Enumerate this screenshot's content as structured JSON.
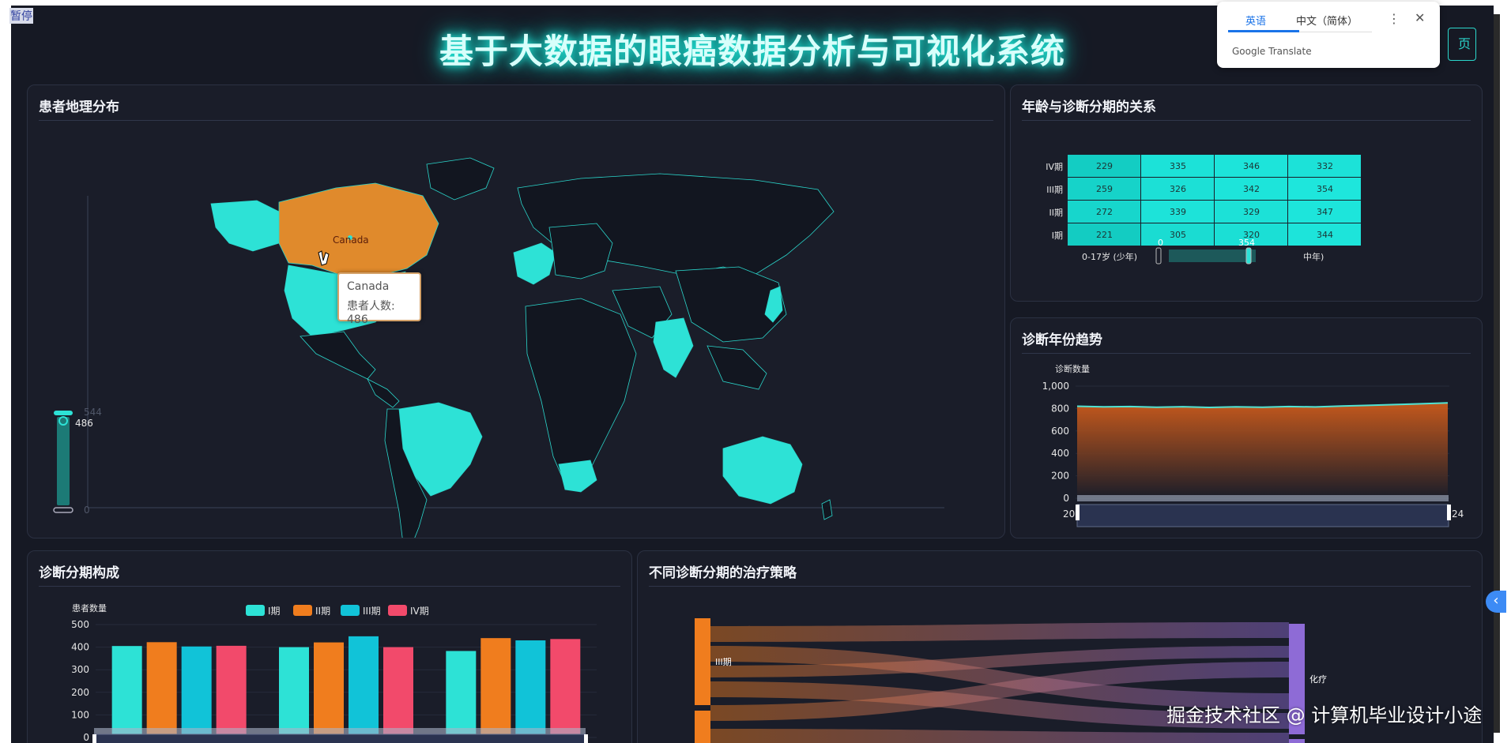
{
  "overlay": {
    "pause_label": "暂停",
    "home_button_fragment": "页",
    "watermark": "掘金技术社区 @ 计算机毕业设计小途"
  },
  "translate_popup": {
    "tab_english": "英语",
    "tab_chinese": "中文（简体）",
    "brand": "Google Translate"
  },
  "header": {
    "title": "基于大数据的眼癌数据分析与可视化系统"
  },
  "panels": {
    "map": {
      "title": "患者地理分布",
      "tooltip_country": "Canada",
      "tooltip_value": "患者人数: 486",
      "highlight_label": "Canada",
      "visualmap_max": "544",
      "visualmap_current": "486",
      "visualmap_min": "0"
    },
    "heatmap": {
      "title": "年龄与诊断分期的关系"
    },
    "trend": {
      "title": "诊断年份趋势"
    },
    "stage_bar": {
      "title": "诊断分期构成"
    },
    "sankey": {
      "title": "不同诊断分期的治疗策略"
    }
  },
  "chart_data": [
    {
      "type": "heatmap",
      "title": "年龄与诊断分期的关系",
      "y_categories": [
        "I期",
        "II期",
        "III期",
        "IV期"
      ],
      "x_categories_visible": [
        "0-17岁 (少年)",
        "中年)"
      ],
      "values": [
        [
          221,
          305,
          320,
          344
        ],
        [
          272,
          339,
          329,
          347
        ],
        [
          259,
          326,
          342,
          354
        ],
        [
          229,
          335,
          346,
          332
        ]
      ],
      "visualmap": {
        "min_label": "0",
        "max_label": "354"
      },
      "colors": {
        "low": "#1a2029",
        "high": "#27e6da"
      }
    },
    {
      "type": "area",
      "title": "诊断年份趋势",
      "ylabel": "诊断数量",
      "ylim": [
        0,
        1000
      ],
      "y_ticks": [
        "1,000",
        "800",
        "600",
        "400",
        "200",
        "0"
      ],
      "x_range_labels": [
        "20",
        "24"
      ],
      "values": [
        820,
        815,
        818,
        812,
        816,
        810,
        815,
        812,
        818,
        814,
        822,
        828,
        835,
        842,
        850
      ],
      "colors": {
        "line": "#4fe3d3",
        "fill_top": "#e0621a",
        "fill_bottom": "#1a1d29"
      }
    },
    {
      "type": "bar",
      "title": "诊断分期构成",
      "ylabel": "患者数量",
      "ylim": [
        0,
        500
      ],
      "y_ticks": [
        "500",
        "400",
        "300",
        "200",
        "100",
        "0"
      ],
      "series": [
        {
          "name": "I期",
          "color": "#2de2d6",
          "values": [
            405,
            400,
            383
          ]
        },
        {
          "name": "II期",
          "color": "#f07d1e",
          "values": [
            422,
            421,
            440
          ]
        },
        {
          "name": "III期",
          "color": "#11c3d8",
          "values": [
            403,
            448,
            430
          ]
        },
        {
          "name": "IV期",
          "color": "#f24a6b",
          "values": [
            406,
            400,
            436
          ]
        }
      ]
    },
    {
      "type": "sankey",
      "title": "不同诊断分期的治疗策略",
      "nodes": [
        "III期",
        "化疗"
      ],
      "colors": {
        "left": "#f07d1e",
        "right": "#8e6bd6"
      }
    }
  ]
}
